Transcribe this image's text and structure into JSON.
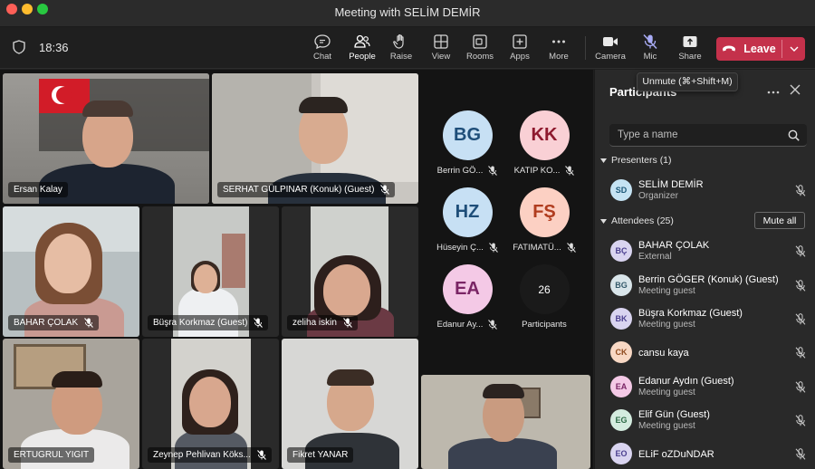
{
  "window": {
    "title": "Meeting with SELİM DEMİR"
  },
  "toolbar": {
    "time": "18:36",
    "buttons": [
      {
        "label": "Chat",
        "icon": "chat-icon"
      },
      {
        "label": "People",
        "icon": "people-icon",
        "active": true
      },
      {
        "label": "Raise",
        "icon": "raise-hand-icon"
      },
      {
        "label": "View",
        "icon": "view-icon"
      },
      {
        "label": "Rooms",
        "icon": "rooms-icon"
      },
      {
        "label": "Apps",
        "icon": "apps-icon"
      },
      {
        "label": "More",
        "icon": "more-icon"
      },
      {
        "label": "Camera",
        "icon": "camera-icon"
      },
      {
        "label": "Mic",
        "icon": "mic-off-icon"
      },
      {
        "label": "Share",
        "icon": "share-icon"
      }
    ],
    "leave_label": "Leave",
    "leave_color": "#c4314b"
  },
  "tooltip": "Unmute (⌘+Shift+M)",
  "videos": [
    {
      "name": "Ersan Kalay",
      "muted": false
    },
    {
      "name": "SERHAT GÜLPINAR (Konuk) (Guest)",
      "muted": true
    },
    {
      "name": "BAHAR ÇOLAK",
      "muted": true
    },
    {
      "name": "Büşra Korkmaz (Guest)",
      "muted": true
    },
    {
      "name": "zeliha iskin",
      "muted": true
    },
    {
      "name": "ERTUGRUL YIGIT",
      "muted": false
    },
    {
      "name": "Zeynep Pehlivan Köks...",
      "muted": true
    },
    {
      "name": "Fikret YANAR",
      "muted": false
    }
  ],
  "avatar_tiles": [
    {
      "initials": "BG",
      "name": "Berrin GÖ...",
      "bg": "#c7e0f4",
      "fg": "#1e4e79"
    },
    {
      "initials": "KK",
      "name": "KATIP KO...",
      "bg": "#f9d0d5",
      "fg": "#8e192e"
    },
    {
      "initials": "HZ",
      "name": "Hüseyin Ç...",
      "bg": "#c7e0f4",
      "fg": "#1e4e79"
    },
    {
      "initials": "FŞ",
      "name": "FATIMATÜ...",
      "bg": "#fcd0c3",
      "fg": "#b03c1e"
    },
    {
      "initials": "EA",
      "name": "Edanur Ay...",
      "bg": "#f4c9e6",
      "fg": "#7a2565"
    },
    {
      "initials": "26",
      "name": "Participants",
      "bg": "#1a1a1a",
      "fg": "#ffffff"
    }
  ],
  "panel": {
    "title": "Participants",
    "search_placeholder": "Type a name",
    "presenters_label": "Presenters (1)",
    "attendees_label": "Attendees (25)",
    "mute_all_label": "Mute all",
    "presenters": [
      {
        "initials": "SD",
        "name": "SELİM DEMİR",
        "sub": "Organizer",
        "bg": "#c5e3f3",
        "fg": "#1e5a7a"
      }
    ],
    "attendees": [
      {
        "initials": "BÇ",
        "name": "BAHAR ÇOLAK",
        "sub": "External",
        "bg": "#d9d4f0",
        "fg": "#4b3f8f"
      },
      {
        "initials": "BG",
        "name": "Berrin GÖGER (Konuk) (Guest)",
        "sub": "Meeting guest",
        "bg": "#d9e5ea",
        "fg": "#355a6b"
      },
      {
        "initials": "BK",
        "name": "Büşra Korkmaz (Guest)",
        "sub": "Meeting guest",
        "bg": "#d9d4f0",
        "fg": "#4b3f8f"
      },
      {
        "initials": "CK",
        "name": "cansu kaya",
        "sub": "",
        "bg": "#f8d8c4",
        "fg": "#8f4a1e"
      },
      {
        "initials": "EA",
        "name": "Edanur Aydın (Guest)",
        "sub": "Meeting guest",
        "bg": "#f4c9e6",
        "fg": "#7a2565"
      },
      {
        "initials": "EG",
        "name": "Elif Gün (Guest)",
        "sub": "Meeting guest",
        "bg": "#d4ecdf",
        "fg": "#2e6b47"
      },
      {
        "initials": "EO",
        "name": "ELiF oZDuNDAR",
        "sub": "",
        "bg": "#d9d4f0",
        "fg": "#4b3f8f"
      }
    ]
  }
}
